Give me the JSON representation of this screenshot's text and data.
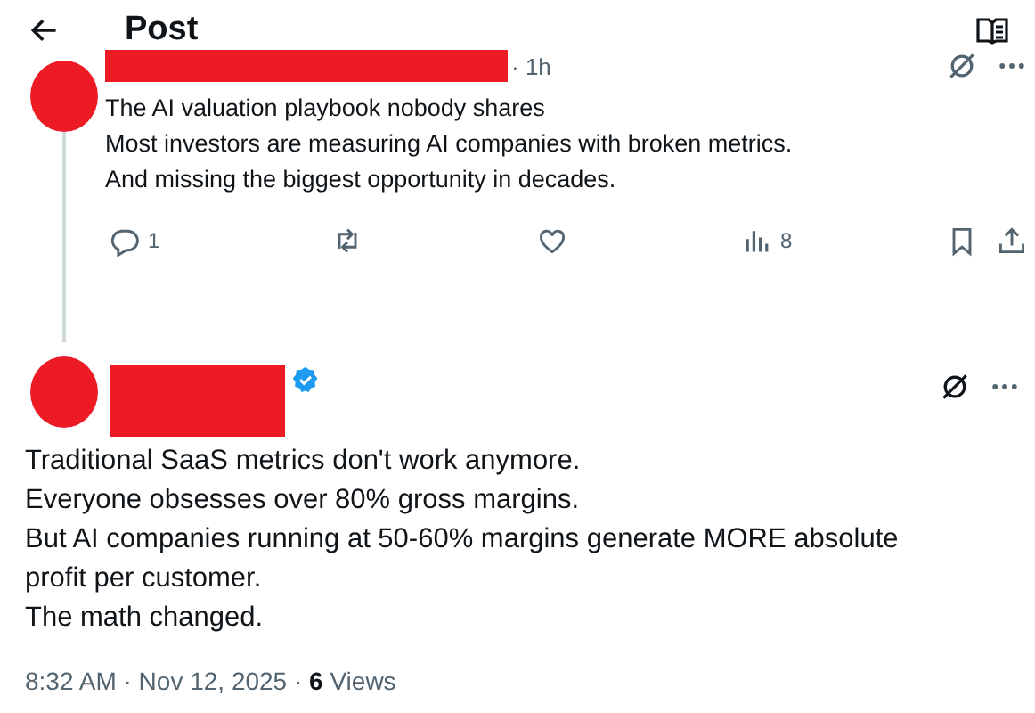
{
  "header": {
    "title": "Post"
  },
  "reply_post": {
    "time": "· 1h",
    "lines": [
      "The AI valuation playbook nobody shares",
      "Most investors are measuring AI companies with broken metrics.",
      "And missing the biggest opportunity in decades."
    ],
    "actions": [
      {
        "kind": "reply",
        "count": "1"
      },
      {
        "kind": "repost"
      },
      {
        "kind": "like"
      },
      {
        "kind": "views",
        "count": "8"
      }
    ]
  },
  "main_post": {
    "verified": true,
    "lines": [
      "Traditional SaaS metrics don't work anymore.",
      "Everyone obsesses over 80% gross margins.",
      "But AI companies running at 50-60% margins generate MORE absolute",
      "profit per customer.",
      "The math changed."
    ],
    "footer": "8:32 AM · Nov 12, 2025 · **6** Views"
  }
}
